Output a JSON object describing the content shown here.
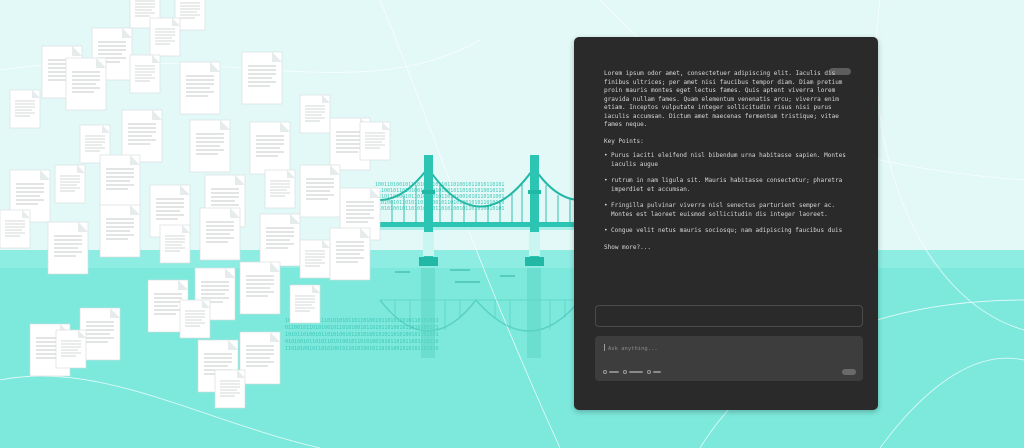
{
  "colors": {
    "background": "#e2f9f7",
    "water": "#7de9dd",
    "bridge": "#36d1bf",
    "panel": "#2a2a2a",
    "panel_text": "#d8d8d8"
  },
  "assistant": {
    "summary": "Lorem ipsum odor amet, consectetuer adipiscing elit. Iaculis dis finibus ultrices; per amet nisi faucibus tempor diam. Diam pretium proin mauris montes eget lectus fames. Quis aptent viverra lorem gravida nullam fames. Quam elementum venenatis arcu; viverra enim etiam. Inceptos vulputate integer sollicitudin risus nisi purus iaculis accumsan. Dictum amet maecenas fermentum tristique; vitae fames neque.",
    "key_points_title": "Key Points:",
    "key_points": [
      "Purus iaciti eleifend nisl bibendum urna habitasse sapien. Montes iaculis augue",
      "rutrum in nam ligula sit. Mauris habitasse consectetur; pharetra imperdiet et accumsan.",
      "Fringilla pulvinar viverra nisl senectus parturient semper ac. Montes est laoreet euismod sollicitudin dis integer laoreet.",
      "Congue velit netus mauris sociosqu; nam adipiscing faucibus duis"
    ],
    "show_more": "Show more?...",
    "input_placeholder": "Ask anything...",
    "icons": [
      "attach-icon",
      "globe-icon",
      "search-icon"
    ]
  }
}
